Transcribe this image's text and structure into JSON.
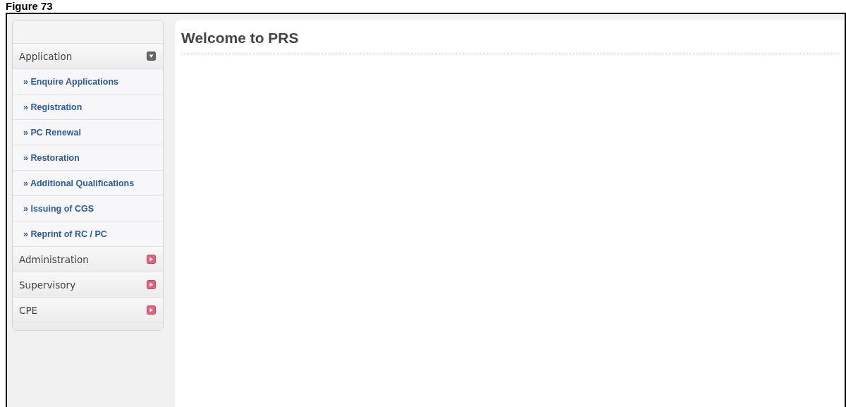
{
  "caption": "Figure 73",
  "sidebar": {
    "sections": [
      {
        "label": "Application",
        "expanded": true,
        "children": [
          {
            "label": "» Enquire Applications"
          },
          {
            "label": "» Registration"
          },
          {
            "label": "» PC Renewal"
          },
          {
            "label": "» Restoration"
          },
          {
            "label": "» Additional Qualifications"
          },
          {
            "label": "» Issuing of CGS"
          },
          {
            "label": "» Reprint of RC / PC"
          }
        ]
      },
      {
        "label": "Administration",
        "expanded": false
      },
      {
        "label": "Supervisory",
        "expanded": false
      },
      {
        "label": "CPE",
        "expanded": false
      }
    ]
  },
  "main": {
    "title": "Welcome to PRS"
  }
}
